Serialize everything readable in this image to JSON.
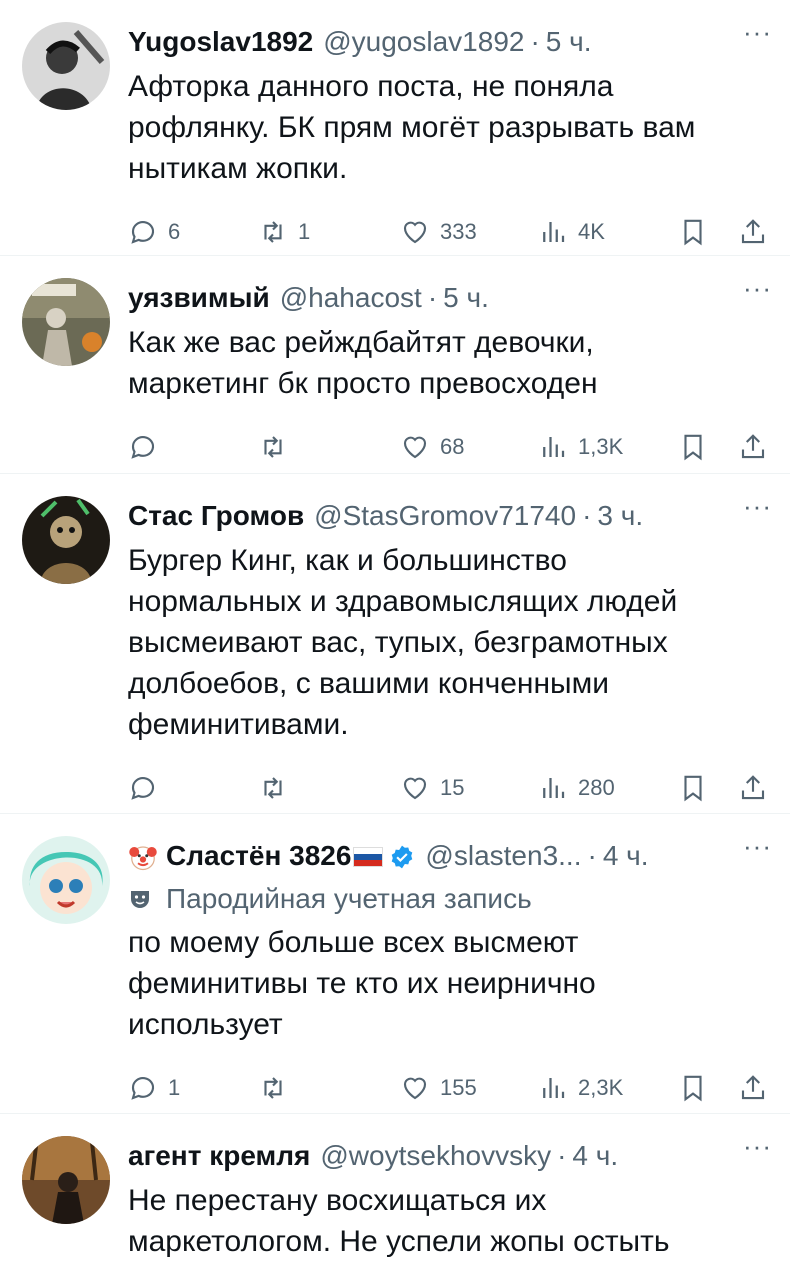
{
  "tweets": [
    {
      "name": "Yugoslav1892",
      "handle": "@yugoslav1892",
      "time": "5 ч.",
      "text": "Афторка данного поста, не поняла\nрофлянку. БК прям могёт разрывать вам\nнытикам жопки.",
      "replies": "6",
      "retweets": "1",
      "likes": "333",
      "views": "4K"
    },
    {
      "name": "уязвимый",
      "handle": "@hahacost",
      "time": "5 ч.",
      "text": "Как же вас рейждбайтят девочки,\nмаркетинг бк просто превосходен",
      "replies": "",
      "retweets": "",
      "likes": "68",
      "views": "1,3K"
    },
    {
      "name": "Стас Громов",
      "handle": "@StasGromov71740",
      "time": "3 ч.",
      "text": "Бургер Кинг, как и большинство\nнормальных и здравомыслящих людей\nвысмеивают вас, тупых, безграмотных\nдолбоебов, с вашими конченными\nфеминитивами.",
      "replies": "",
      "retweets": "",
      "likes": "15",
      "views": "280"
    },
    {
      "name": "Сластён 3826",
      "handle": "@slasten3...",
      "time": "4 ч.",
      "label": "Пародийная учетная запись",
      "text": "по моему больше всех высмеют\nфеминитивы те кто их неирнично\nиспользует",
      "replies": "1",
      "retweets": "",
      "likes": "155",
      "views": "2,3K"
    },
    {
      "name": "агент кремля",
      "handle": "@woytsekhovvsky",
      "time": "4 ч.",
      "text": "Не перестану восхищаться их\nмаркетологом. Не успели жопы остыть"
    }
  ],
  "separator": "·",
  "more": "···",
  "colors": {
    "text": "#0f1419",
    "secondary": "#536471",
    "border": "#eff3f4",
    "verified": "#1d9bf0"
  },
  "icons": [
    "reply-icon",
    "retweet-icon",
    "like-icon",
    "views-icon",
    "bookmark-icon",
    "share-icon",
    "more-icon",
    "verified-icon",
    "parody-mask-icon",
    "clown-emoji",
    "russia-flag"
  ]
}
